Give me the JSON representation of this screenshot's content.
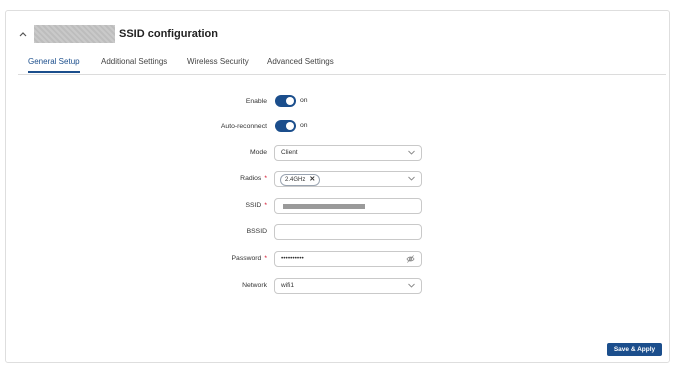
{
  "section": {
    "title": "SSID configuration"
  },
  "tabs": [
    {
      "label": "General Setup",
      "active": true
    },
    {
      "label": "Additional Settings",
      "active": false
    },
    {
      "label": "Wireless Security",
      "active": false
    },
    {
      "label": "Advanced Settings",
      "active": false
    }
  ],
  "form": {
    "enable": {
      "label": "Enable",
      "state_label": "on",
      "checked": true
    },
    "auto_reconnect": {
      "label": "Auto-reconnect",
      "state_label": "on",
      "checked": true
    },
    "mode": {
      "label": "Mode",
      "value": "Client"
    },
    "radios": {
      "label": "Radios",
      "required_marker": "*",
      "chip": "2.4GHz",
      "chip_remove": "✕"
    },
    "ssid": {
      "label": "SSID",
      "required_marker": "*"
    },
    "bssid": {
      "label": "BSSID",
      "value": ""
    },
    "password": {
      "label": "Password",
      "required_marker": "*",
      "value": "••••••••••"
    },
    "network": {
      "label": "Network",
      "value": "wifi1"
    }
  },
  "actions": {
    "save_label": "Save & Apply"
  },
  "colors": {
    "accent": "#1b4e8c",
    "required": "#d0021b"
  }
}
